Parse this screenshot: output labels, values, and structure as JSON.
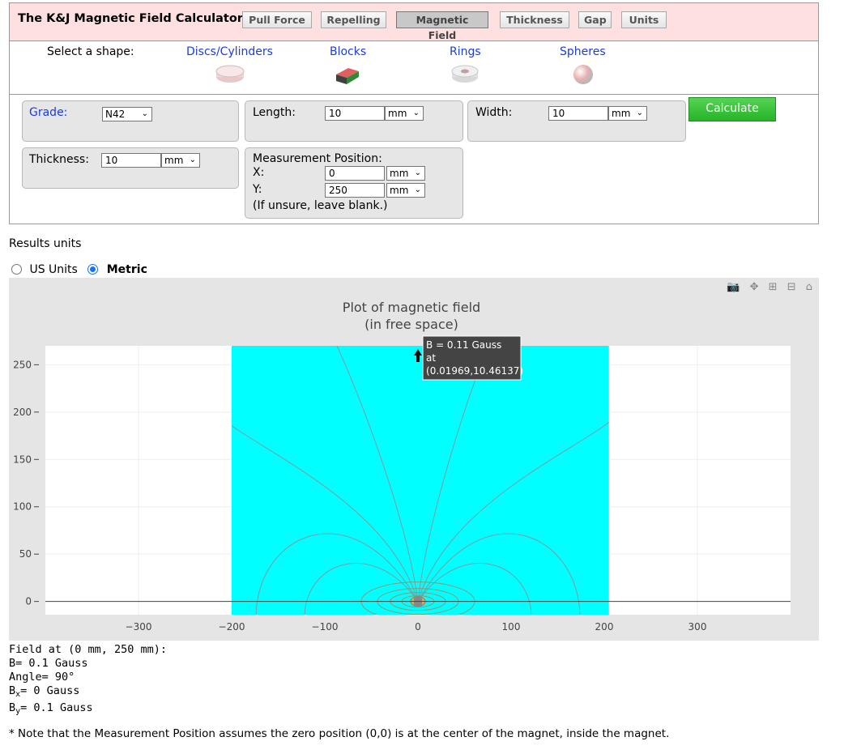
{
  "header": {
    "title": "The K&J Magnetic Field Calculator",
    "nav": [
      "Pull Force",
      "Repelling",
      "Magnetic Field",
      "Thickness",
      "Gap",
      "Units"
    ],
    "active_nav": "Magnetic Field"
  },
  "shapes": {
    "label": "Select a shape:",
    "items": [
      "Discs/Cylinders",
      "Blocks",
      "Rings",
      "Spheres"
    ],
    "selected": "Blocks"
  },
  "form": {
    "grade_label": "Grade:",
    "grade_value": "N42",
    "length_label": "Length:",
    "length_value": "10",
    "length_unit": "mm",
    "width_label": "Width:",
    "width_value": "10",
    "width_unit": "mm",
    "thickness_label": "Thickness:",
    "thickness_value": "10",
    "thickness_unit": "mm",
    "position_label": "Measurement Position:",
    "x_label": "X:",
    "x_value": "0",
    "x_unit": "mm",
    "y_label": "Y:",
    "y_value": "250",
    "y_unit": "mm",
    "position_hint": "(If unsure, leave blank.)",
    "calculate_label": "Calculate"
  },
  "results_units": {
    "title": "Results units",
    "options": [
      "US Units",
      "Metric"
    ],
    "selected": "Metric"
  },
  "plot": {
    "title_line1": "Plot of magnetic field",
    "title_line2": "(in free space)",
    "tooltip_line1": "B = 0.11 Gauss",
    "tooltip_line2": "at",
    "tooltip_line3": "(0.01969,10.46137)",
    "background_color": "#00ffff"
  },
  "chart_data": {
    "type": "contour",
    "title": "Plot of magnetic field (in free space)",
    "x_ticks": [
      -300,
      -200,
      -100,
      0,
      100,
      200,
      300
    ],
    "y_ticks": [
      0,
      50,
      100,
      150,
      200,
      250
    ],
    "xlim": [
      -400,
      400
    ],
    "ylim": [
      -14,
      270
    ],
    "field_region_x": [
      -200,
      205
    ],
    "field_region_y": [
      -14,
      270
    ],
    "grid": true,
    "hover_point": {
      "x": 0.01969,
      "y": 10.46137,
      "B": 0.11,
      "unit": "Gauss"
    },
    "measurement_point": {
      "x": 0,
      "y": 250
    }
  },
  "readout": {
    "heading": "Field at (0 mm, 250 mm):",
    "b": "B= 0.1 Gauss",
    "angle": "Angle= 90°",
    "bx_prefix": "B",
    "bx_sub": "x",
    "bx_rest": "= 0 Gauss",
    "by_prefix": "B",
    "by_sub": "y",
    "by_rest": "= 0.1 Gauss"
  },
  "note": "* Note that the Measurement Position assumes the zero position (0,0) is at the center of the magnet, inside the magnet."
}
